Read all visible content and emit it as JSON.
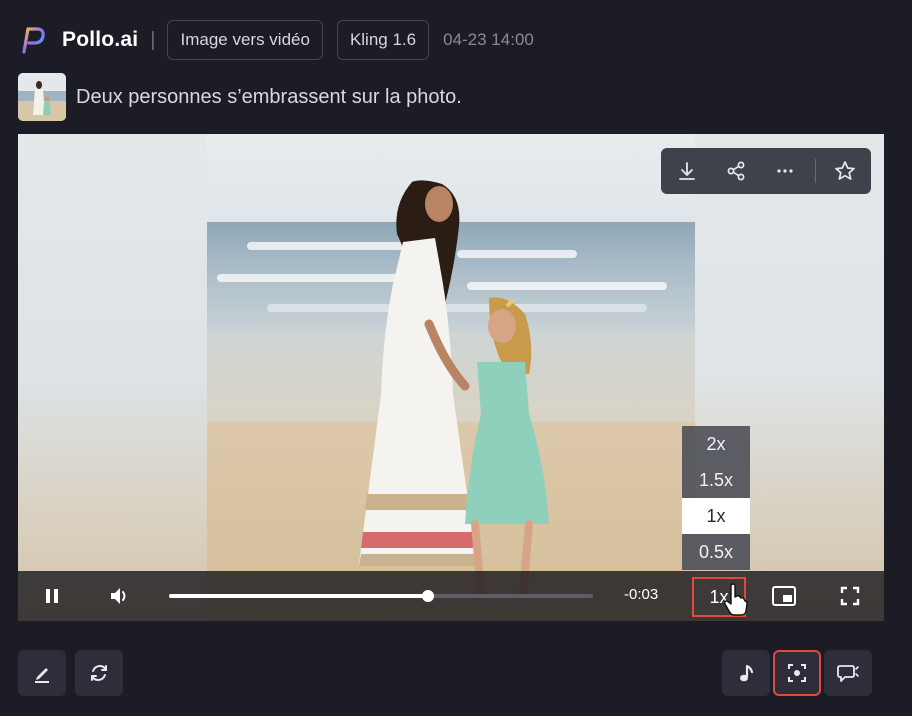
{
  "header": {
    "brand": "Pollo.ai",
    "separator": "|",
    "mode_chip": "Image vers vidéo",
    "model_chip": "Kling 1.6",
    "timestamp": "04-23 14:00"
  },
  "prompt": {
    "text": "Deux personnes s’embrassent sur la photo."
  },
  "video": {
    "actions": [
      {
        "name": "download-icon"
      },
      {
        "name": "share-icon"
      },
      {
        "name": "more-icon"
      },
      {
        "name": "star-icon"
      }
    ],
    "speed_options": [
      "2x",
      "1.5x",
      "1x",
      "0.5x"
    ],
    "selected_speed": "1x",
    "progress": 0.61,
    "time_remaining": "-0:03",
    "speed_label": "1x"
  },
  "colors": {
    "background": "#1c1c26",
    "highlight": "#e04a3a",
    "button_bg": "#2e2e3a"
  }
}
